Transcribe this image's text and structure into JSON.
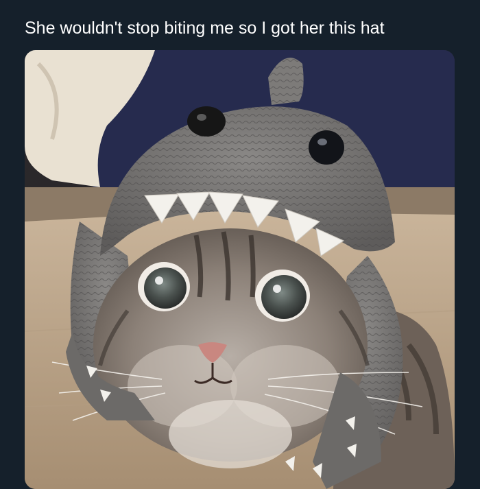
{
  "post": {
    "text": "She wouldn't stop biting me so I got her this hat"
  },
  "media": {
    "alt": "Tabby cat wearing a grey crocheted shark hat with white felt teeth and black button eyes, peeking over a wooden table"
  }
}
